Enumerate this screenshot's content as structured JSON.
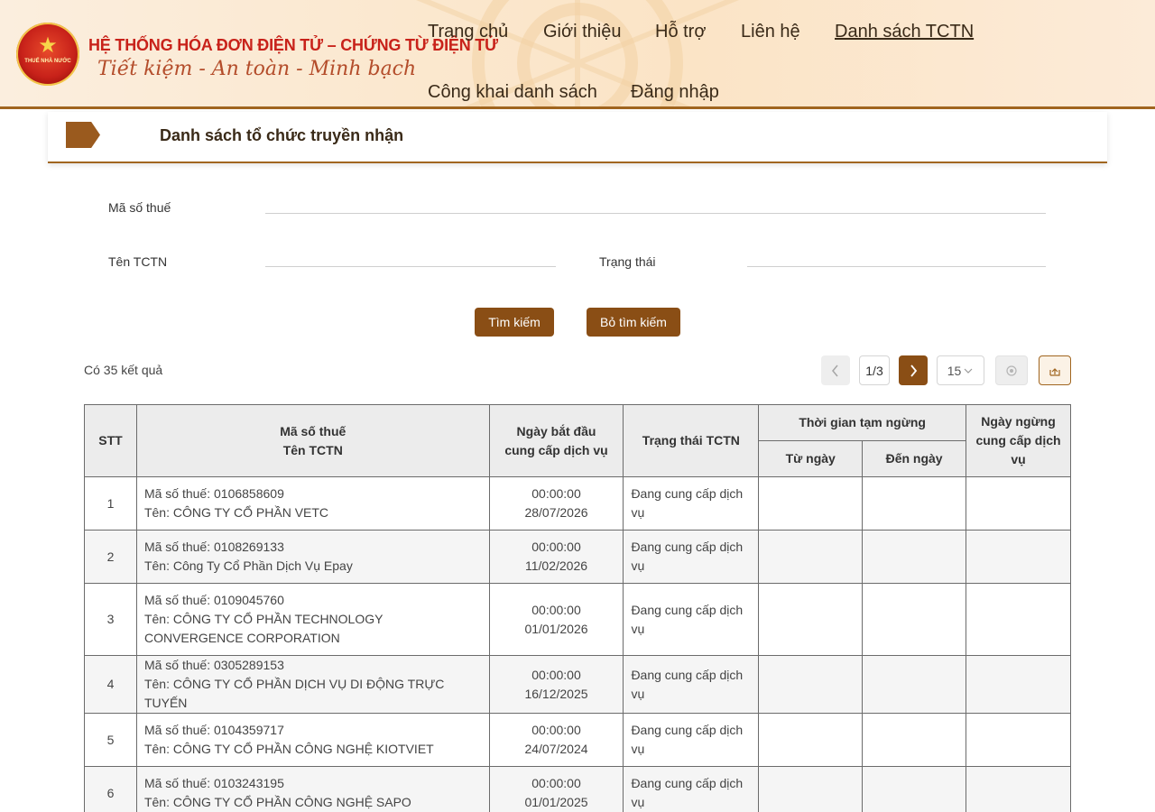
{
  "header": {
    "emblem_text": "THUẾ NHÀ NƯỚC",
    "title": "HỆ THỐNG HÓA ĐƠN ĐIỆN TỬ – CHỨNG TỪ ĐIỆN TỬ",
    "slogan": "Tiết kiệm - An toàn - Minh bạch",
    "nav": [
      {
        "label": "Trang chủ"
      },
      {
        "label": "Giới thiệu"
      },
      {
        "label": "Hỗ trợ"
      },
      {
        "label": "Liên hệ"
      },
      {
        "label": "Danh sách TCTN",
        "active": true
      },
      {
        "label": "Công khai danh sách"
      },
      {
        "label": "Đăng nhập"
      }
    ]
  },
  "panel": {
    "title": "Danh sách tổ chức truyền nhận"
  },
  "form": {
    "tax_code_label": "Mã số thuế",
    "tax_code_value": "",
    "name_label": "Tên TCTN",
    "name_value": "",
    "status_label": "Trạng thái",
    "status_value": "",
    "search_button": "Tìm kiếm",
    "clear_button": "Bỏ tìm kiếm"
  },
  "results": {
    "count_text": "Có 35 kết quả"
  },
  "pager": {
    "page": "1/3",
    "page_size": "15",
    "prev_icon": "chevron-left",
    "next_icon": "chevron-right",
    "size_icon": "chevron-down"
  },
  "table": {
    "headers": {
      "stt": "STT",
      "ma_so_thue": "Mã số thuế",
      "ten_tctn": "Tên TCTN",
      "ngay_bat_dau": "Ngày bắt đầu cung cấp dịch vụ",
      "trang_thai": "Trạng thái TCTN",
      "thoi_gian_tam_ngung": "Thời gian tạm ngừng",
      "tu_ngay": "Từ ngày",
      "den_ngay": "Đến ngày",
      "ngay_ngung": "Ngày ngừng cung cấp dịch vụ"
    },
    "rows": [
      {
        "stt": "1",
        "tax": "Mã số thuế: 0106858609",
        "name": "Tên: CÔNG TY CỔ PHẦN VETC",
        "time": "00:00:00",
        "date": "28/07/2026",
        "status": "Đang cung cấp dịch vụ",
        "from": "",
        "to": "",
        "stop": ""
      },
      {
        "stt": "2",
        "tax": "Mã số thuế: 0108269133",
        "name": "Tên: Công Ty Cổ Phần Dịch Vụ Epay",
        "time": "00:00:00",
        "date": "11/02/2026",
        "status": "Đang cung cấp dịch vụ",
        "from": "",
        "to": "",
        "stop": ""
      },
      {
        "stt": "3",
        "tax": "Mã số thuế: 0109045760",
        "name": "Tên: CÔNG TY CỔ PHẦN TECHNOLOGY CONVERGENCE CORPORATION",
        "time": "00:00:00",
        "date": "01/01/2026",
        "status": "Đang cung cấp dịch vụ",
        "from": "",
        "to": "",
        "stop": ""
      },
      {
        "stt": "4",
        "tax": "Mã số thuế: 0305289153",
        "name": "Tên: CÔNG TY CỔ PHẦN DỊCH VỤ DI ĐỘNG TRỰC TUYẾN",
        "time": "00:00:00",
        "date": "16/12/2025",
        "status": "Đang cung cấp dịch vụ",
        "from": "",
        "to": "",
        "stop": ""
      },
      {
        "stt": "5",
        "tax": "Mã số thuế: 0104359717",
        "name": "Tên: CÔNG TY CỔ PHẦN CÔNG NGHỆ KIOTVIET",
        "time": "00:00:00",
        "date": "24/07/2024",
        "status": "Đang cung cấp dịch vụ",
        "from": "",
        "to": "",
        "stop": ""
      },
      {
        "stt": "6",
        "tax": "Mã số thuế: 0103243195",
        "name": "Tên: CÔNG TY CỔ PHẦN CÔNG NGHỆ SAPO",
        "time": "00:00:00",
        "date": "01/01/2025",
        "status": "Đang cung cấp dịch vụ",
        "from": "",
        "to": "",
        "stop": ""
      }
    ]
  },
  "colors": {
    "brand": "#8a4e15",
    "border": "#a0651f",
    "title_red": "#c8221a"
  }
}
